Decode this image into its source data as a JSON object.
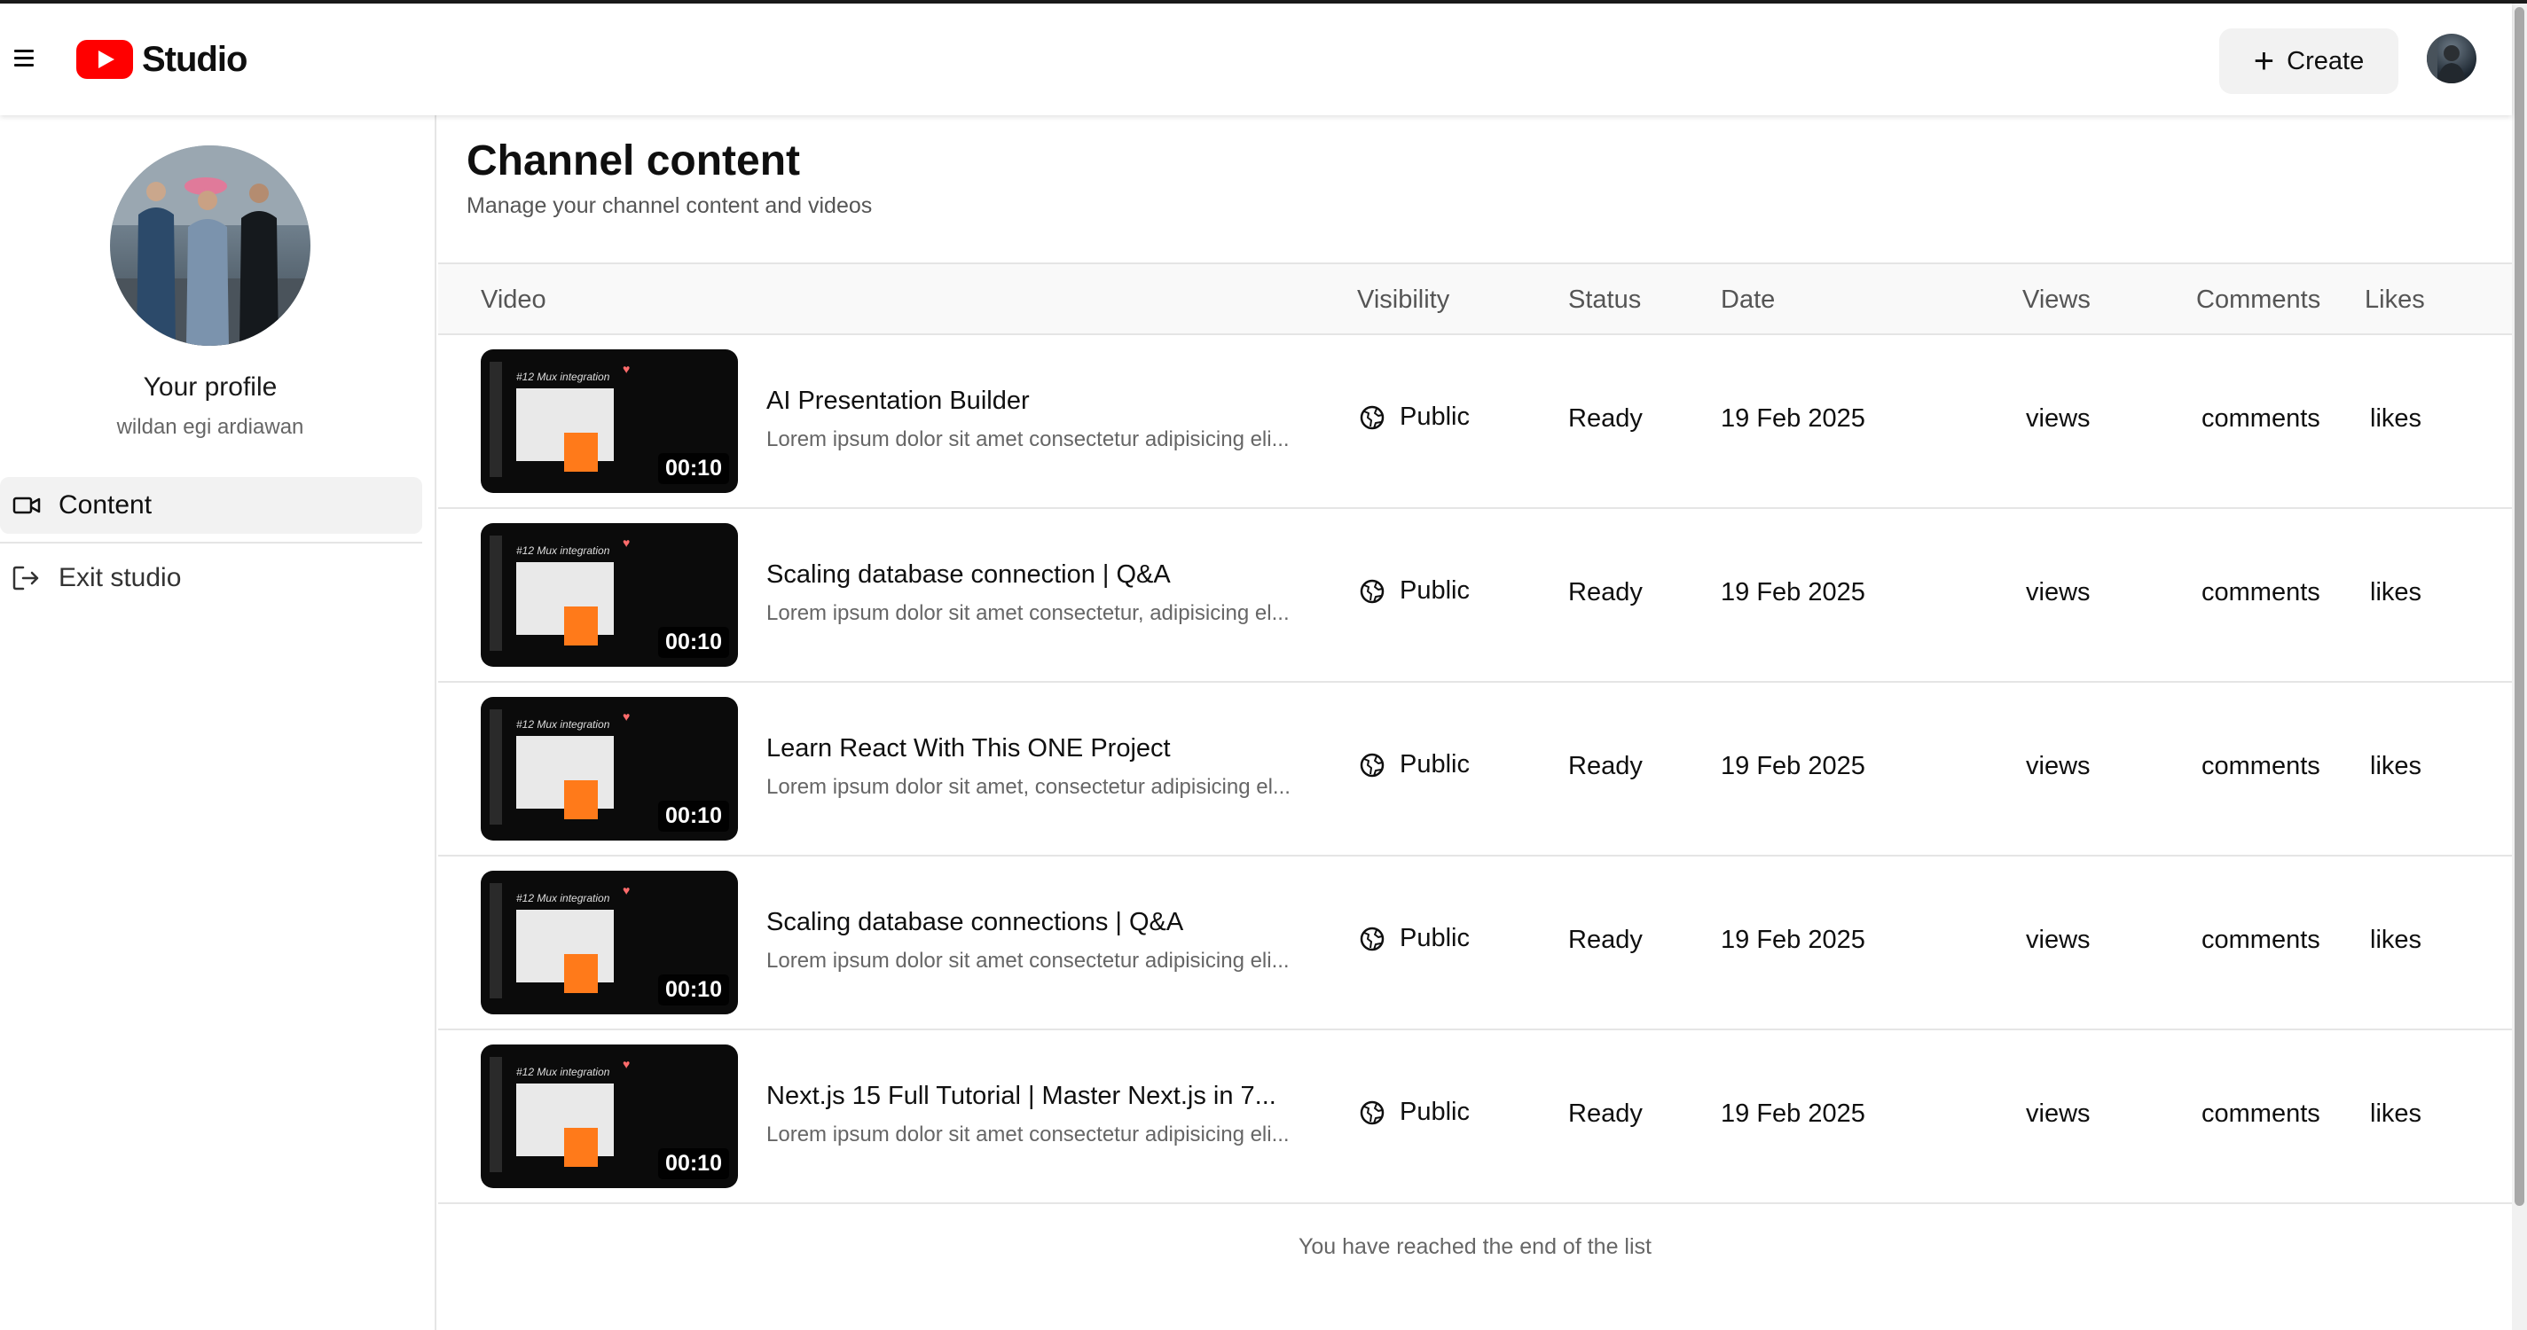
{
  "header": {
    "logo_text": "Studio",
    "create_label": "Create"
  },
  "sidebar": {
    "profile_title": "Your profile",
    "profile_name": "wildan egi ardiawan",
    "items": [
      {
        "label": "Content",
        "icon": "video-camera-icon",
        "active": true
      },
      {
        "label": "Exit studio",
        "icon": "log-out-icon",
        "active": false
      }
    ]
  },
  "main": {
    "title": "Channel content",
    "subtitle": "Manage your channel content and videos",
    "columns": [
      "Video",
      "Visibility",
      "Status",
      "Date",
      "Views",
      "Comments",
      "Likes"
    ],
    "thumbnail_caption": "#12 Mux integration",
    "rows": [
      {
        "title": "AI Presentation Builder",
        "description": "Lorem ipsum dolor sit amet consectetur adipisicing eli...",
        "duration": "00:10",
        "visibility": "Public",
        "status": "Ready",
        "date": "19 Feb 2025",
        "views": "views",
        "comments": "comments",
        "likes": "likes"
      },
      {
        "title": "Scaling database connection | Q&A",
        "description": "Lorem ipsum dolor sit amet consectetur, adipisicing el...",
        "duration": "00:10",
        "visibility": "Public",
        "status": "Ready",
        "date": "19 Feb 2025",
        "views": "views",
        "comments": "comments",
        "likes": "likes"
      },
      {
        "title": "Learn React With This ONE Project",
        "description": "Lorem ipsum dolor sit amet, consectetur adipisicing el...",
        "duration": "00:10",
        "visibility": "Public",
        "status": "Ready",
        "date": "19 Feb 2025",
        "views": "views",
        "comments": "comments",
        "likes": "likes"
      },
      {
        "title": "Scaling database connections | Q&A",
        "description": "Lorem ipsum dolor sit amet consectetur adipisicing eli...",
        "duration": "00:10",
        "visibility": "Public",
        "status": "Ready",
        "date": "19 Feb 2025",
        "views": "views",
        "comments": "comments",
        "likes": "likes"
      },
      {
        "title": "Next.js 15 Full Tutorial | Master Next.js in 7...",
        "description": "Lorem ipsum dolor sit amet consectetur adipisicing eli...",
        "duration": "00:10",
        "visibility": "Public",
        "status": "Ready",
        "date": "19 Feb 2025",
        "views": "views",
        "comments": "comments",
        "likes": "likes"
      }
    ],
    "end_message": "You have reached the end of the list"
  },
  "colors": {
    "brand_red": "#ff0000",
    "accent_orange": "#ff7a1a",
    "active_bg": "#f2f2f2",
    "border": "#e5e5e5"
  }
}
